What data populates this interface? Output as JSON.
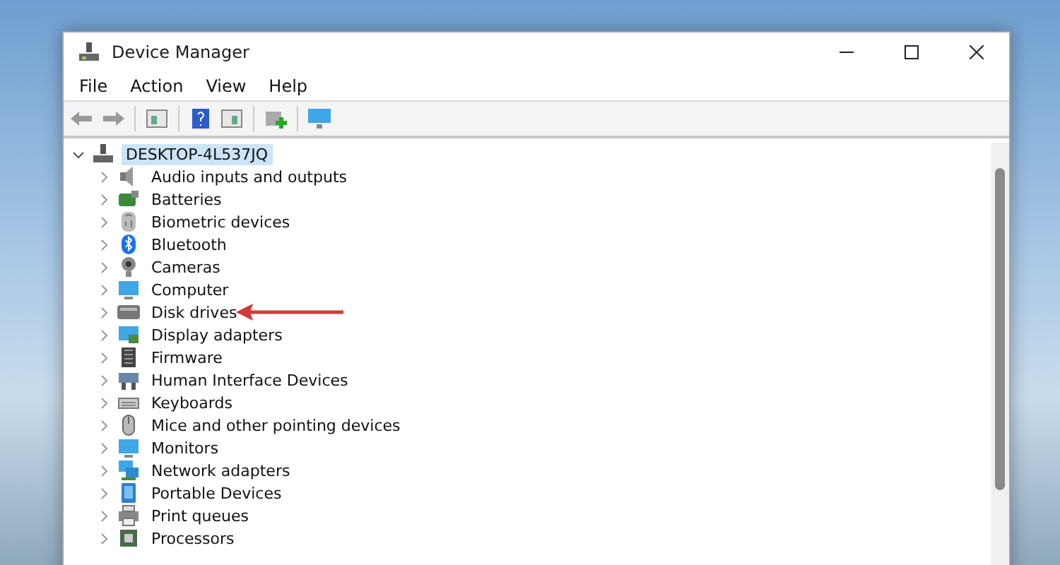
{
  "window": {
    "title": "Device Manager"
  },
  "menu": [
    {
      "label": "File"
    },
    {
      "label": "Action"
    },
    {
      "label": "View"
    },
    {
      "label": "Help"
    }
  ],
  "tree": {
    "label": "DESKTOP-4L537JQ",
    "expanded": true,
    "selected": true,
    "children": [
      {
        "label": "Audio inputs and outputs",
        "expanded": false,
        "selected": false
      },
      {
        "label": "Batteries",
        "expanded": false,
        "selected": false
      },
      {
        "label": "Biometric devices",
        "expanded": false,
        "selected": false
      },
      {
        "label": "Bluetooth",
        "expanded": false,
        "selected": false
      },
      {
        "label": "Cameras",
        "expanded": false,
        "selected": false
      },
      {
        "label": "Computer",
        "expanded": false,
        "selected": false
      },
      {
        "label": "Disk drives",
        "expanded": false,
        "selected": false
      },
      {
        "label": "Display adapters",
        "expanded": false,
        "selected": false
      },
      {
        "label": "Firmware",
        "expanded": false,
        "selected": false
      },
      {
        "label": "Human Interface Devices",
        "expanded": false,
        "selected": false
      },
      {
        "label": "Keyboards",
        "expanded": false,
        "selected": false
      },
      {
        "label": "Mice and other pointing devices",
        "expanded": false,
        "selected": false
      },
      {
        "label": "Monitors",
        "expanded": false,
        "selected": false
      },
      {
        "label": "Network adapters",
        "expanded": false,
        "selected": false
      },
      {
        "label": "Portable Devices",
        "expanded": false,
        "selected": false
      },
      {
        "label": "Print queues",
        "expanded": false,
        "selected": false
      },
      {
        "label": "Processors",
        "expanded": false,
        "selected": false
      }
    ]
  }
}
